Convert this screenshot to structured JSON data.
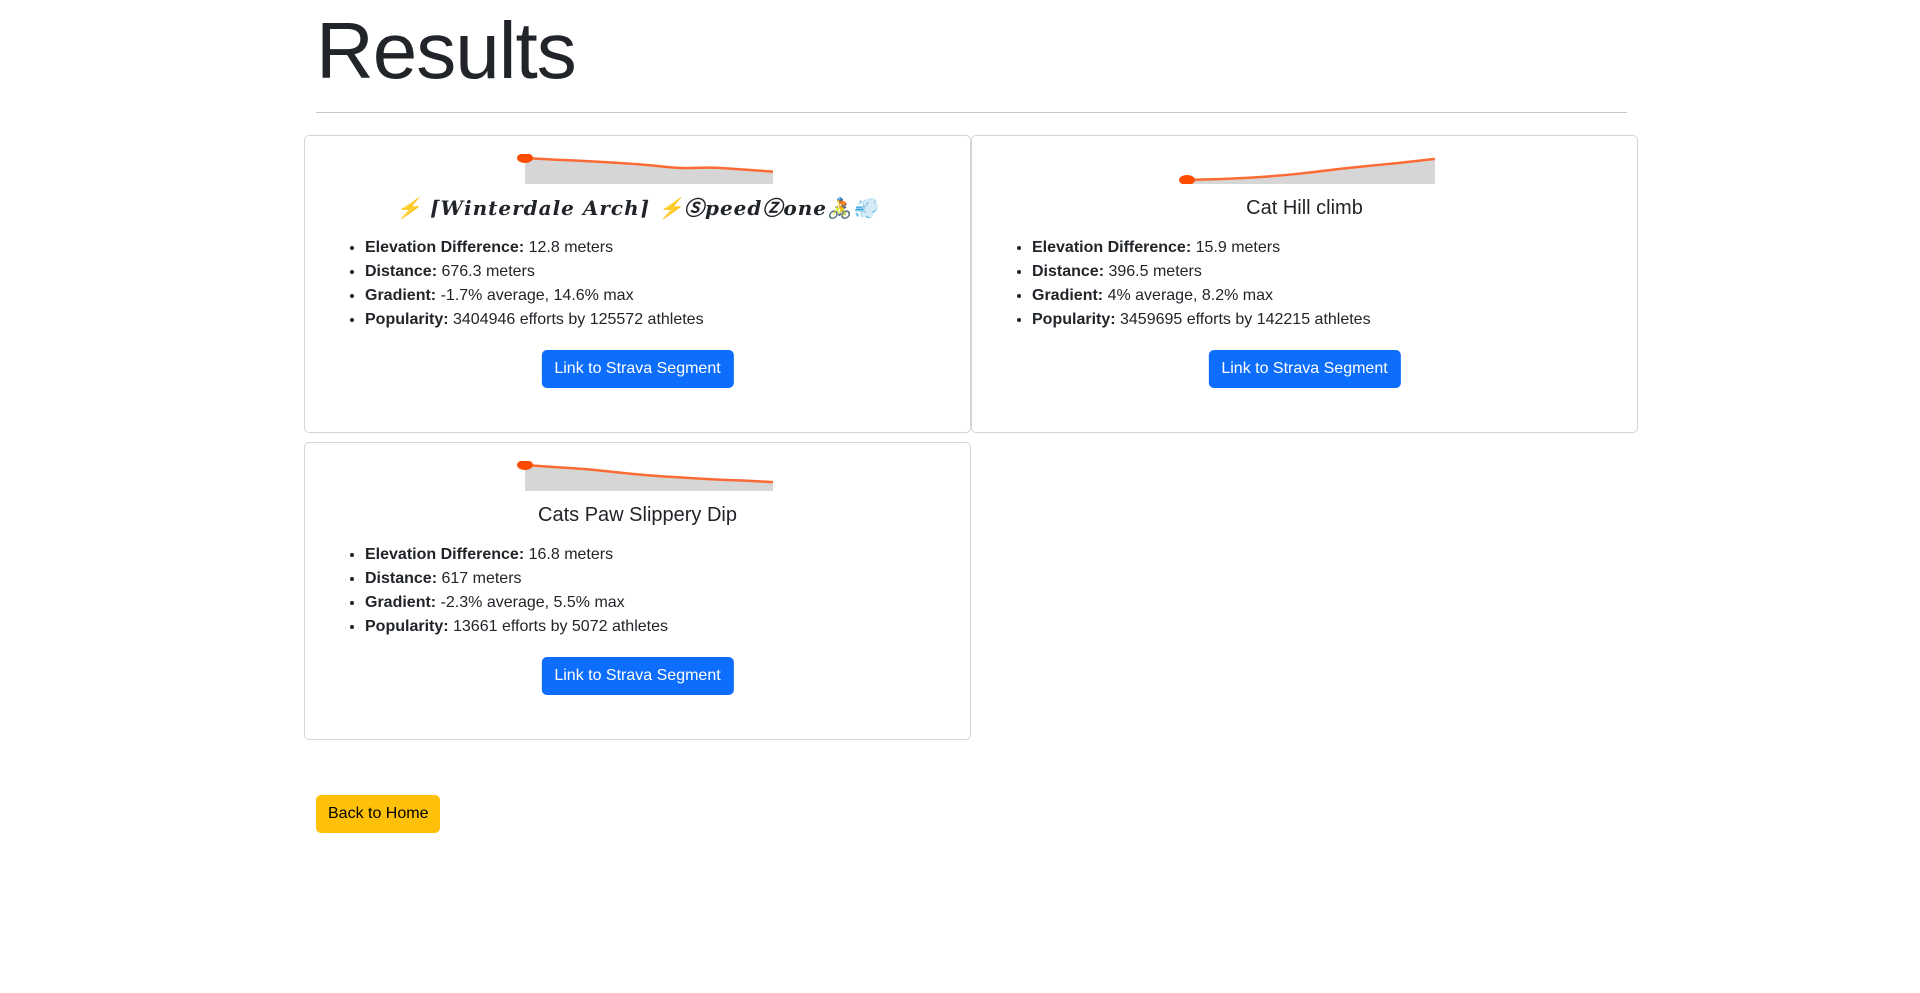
{
  "page": {
    "title": "Results",
    "back_button_label": "Back to Home"
  },
  "colors": {
    "profile_line": "#fc6a35",
    "profile_fill": "#d6d6d6",
    "start_marker": "#fc4c02",
    "primary_button": "#0d6efd",
    "warning_button": "#ffc107"
  },
  "segments": [
    {
      "name": "⚡️ ⌈𝑾𝒊𝒏𝒕𝒆𝒓𝒅𝒂𝒍𝒆 𝑨𝒓𝒄𝒉⌉ ⚡️ⓈpeedⓏone🚴💨",
      "elevation_label": "Elevation Difference:",
      "elevation_value": " 12.8 meters",
      "distance_label": "Distance:",
      "distance_value": " 676.3 meters",
      "gradient_label": "Gradient:",
      "gradient_value": " -1.7% average, 14.6% max",
      "popularity_label": "Popularity:",
      "popularity_value": " 3404946 efforts by 125572 athletes",
      "button_label": "Link to Strava Segment",
      "profile": [
        1.0,
        0.92,
        0.86,
        0.78,
        0.68,
        0.52,
        0.58,
        0.48,
        0.38
      ]
    },
    {
      "name": "Cat Hill climb",
      "elevation_label": "Elevation Difference:",
      "elevation_value": " 15.9 meters",
      "distance_label": "Distance:",
      "distance_value": " 396.5 meters",
      "gradient_label": "Gradient:",
      "gradient_value": " 4% average, 8.2% max",
      "popularity_label": "Popularity:",
      "popularity_value": " 3459695 efforts by 142215 athletes",
      "button_label": "Link to Strava Segment",
      "profile": [
        0.0,
        0.04,
        0.1,
        0.2,
        0.34,
        0.52,
        0.66,
        0.8,
        0.96
      ]
    },
    {
      "name": "Cats Paw Slippery Dip",
      "elevation_label": "Elevation Difference:",
      "elevation_value": " 16.8 meters",
      "distance_label": "Distance:",
      "distance_value": " 617 meters",
      "gradient_label": "Gradient:",
      "gradient_value": " -2.3% average, 5.5% max",
      "popularity_label": "Popularity:",
      "popularity_value": " 13661 efforts by 5072 athletes",
      "button_label": "Link to Strava Segment",
      "profile": [
        1.0,
        0.9,
        0.82,
        0.66,
        0.52,
        0.44,
        0.34,
        0.3,
        0.22
      ]
    }
  ]
}
